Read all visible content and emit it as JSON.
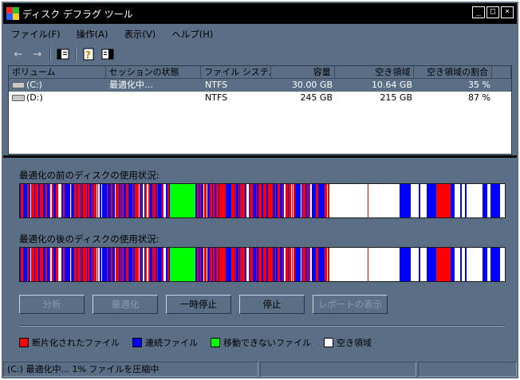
{
  "window": {
    "title": "ディスク デフラグ ツール",
    "controls": [
      "_",
      "□",
      "×"
    ]
  },
  "menu": [
    "ファイル(F)",
    "操作(A)",
    "表示(V)",
    "ヘルプ(H)"
  ],
  "toolbar_icons": [
    "back-arrow-icon",
    "forward-arrow-icon",
    "pane-icon",
    "help-icon",
    "properties-icon"
  ],
  "volumes": {
    "columns": [
      "ボリューム",
      "セッションの状態",
      "ファイル システム",
      "容量",
      "空き領域",
      "空き領域の割合"
    ],
    "rows": [
      {
        "volume": "(C:)",
        "status": "最適化中…",
        "fs": "NTFS",
        "capacity": "30.00 GB",
        "free": "10.64 GB",
        "pct": "35 %",
        "selected": true
      },
      {
        "volume": "(D:)",
        "status": "",
        "fs": "NTFS",
        "capacity": "245 GB",
        "free": "215 GB",
        "pct": "87 %",
        "selected": false
      }
    ]
  },
  "maps": {
    "before_label": "最適化の前のディスクの使用状況:",
    "after_label": "最適化の後のディスクの使用状況:"
  },
  "buttons": {
    "analyze": "分析",
    "defrag": "最適化",
    "pause": "一時停止",
    "stop": "停止",
    "report": "レポートの表示"
  },
  "legend": [
    {
      "label": "断片化されたファイル",
      "color": "#ff0000"
    },
    {
      "label": "連続ファイル",
      "color": "#0000ff"
    },
    {
      "label": "移動できないファイル",
      "color": "#00ff00"
    },
    {
      "label": "空き領域",
      "color": "#ffffff"
    }
  ],
  "status": {
    "text": "(C:) 最適化中... 1% ファイルを圧縮中"
  },
  "colors": {
    "fragmented": "#ff0000",
    "contiguous": "#0000ff",
    "unmovable": "#00ff00",
    "free": "#ffffff",
    "chrome": "#5a6e86"
  }
}
